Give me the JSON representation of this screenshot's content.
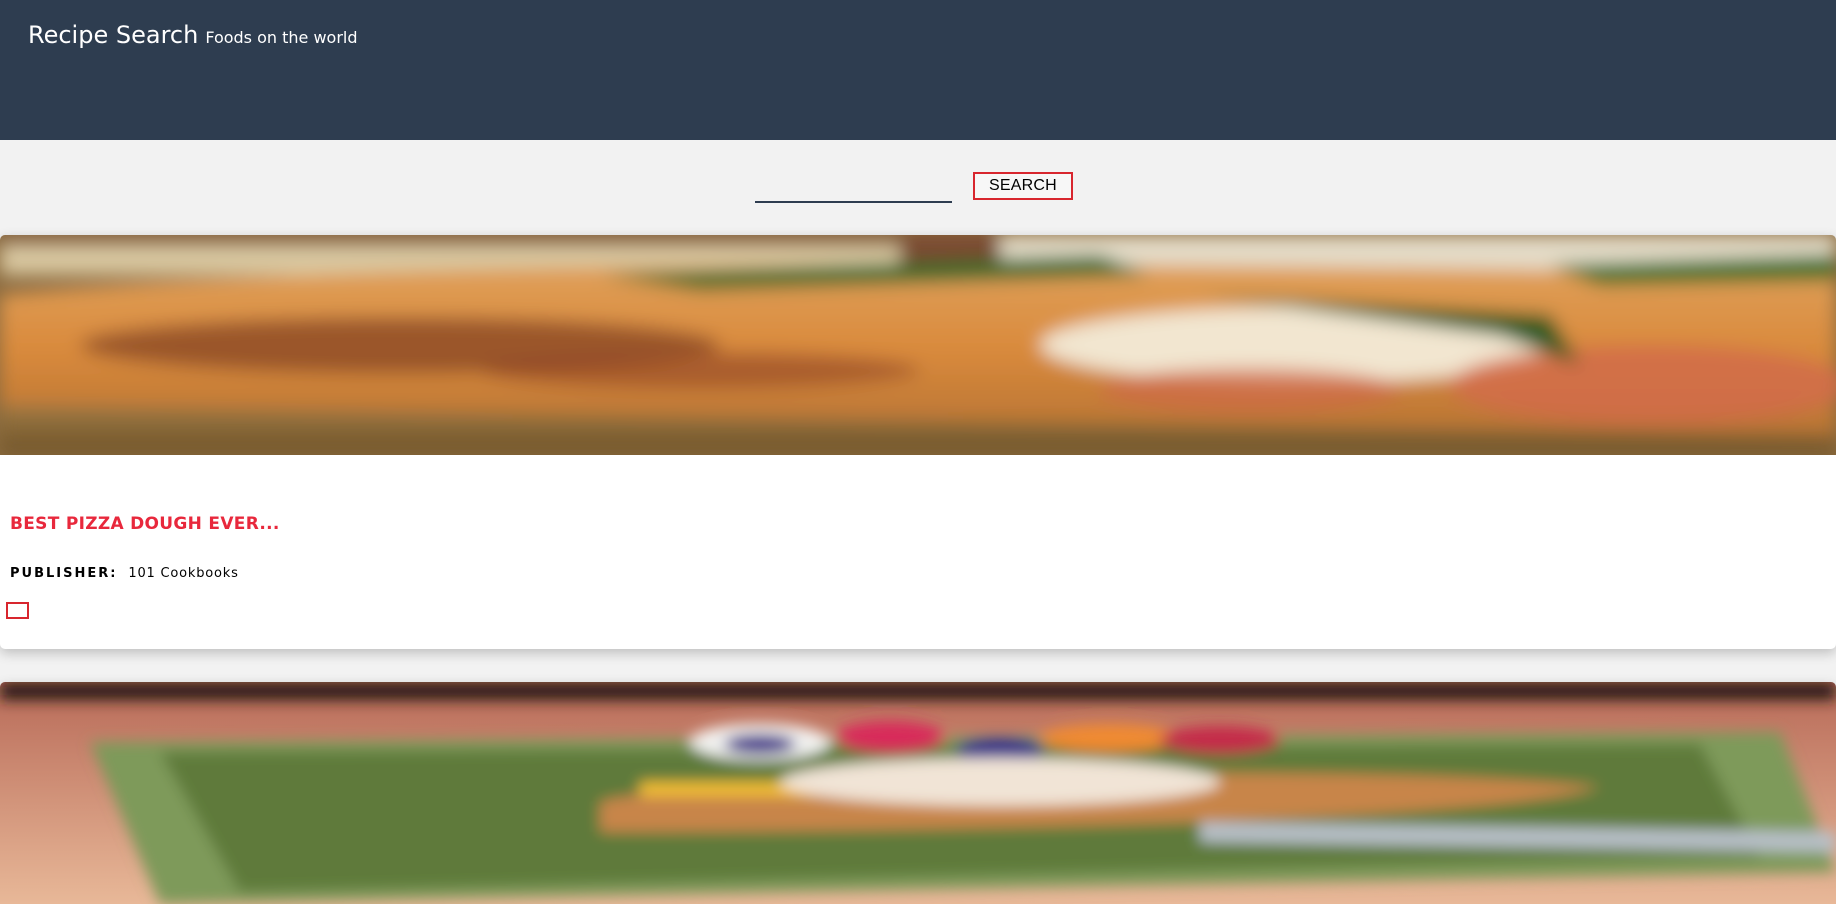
{
  "header": {
    "title": "Recipe Search",
    "subtitle": "Foods on the world",
    "background": "#2e3d50"
  },
  "search": {
    "value": "",
    "placeholder": "",
    "button_label": "SEARCH",
    "accent": "#d8262e"
  },
  "recipes": [
    {
      "title": "Best Pizza Dough Ever...",
      "publisher_label": "PUBLISHER:",
      "publisher": "101 Cookbooks",
      "image": "pizza-crust-photo",
      "title_color": "#e8283c"
    },
    {
      "title": "",
      "publisher_label": "",
      "publisher": "",
      "image": "dessert-pizza-photo"
    }
  ]
}
